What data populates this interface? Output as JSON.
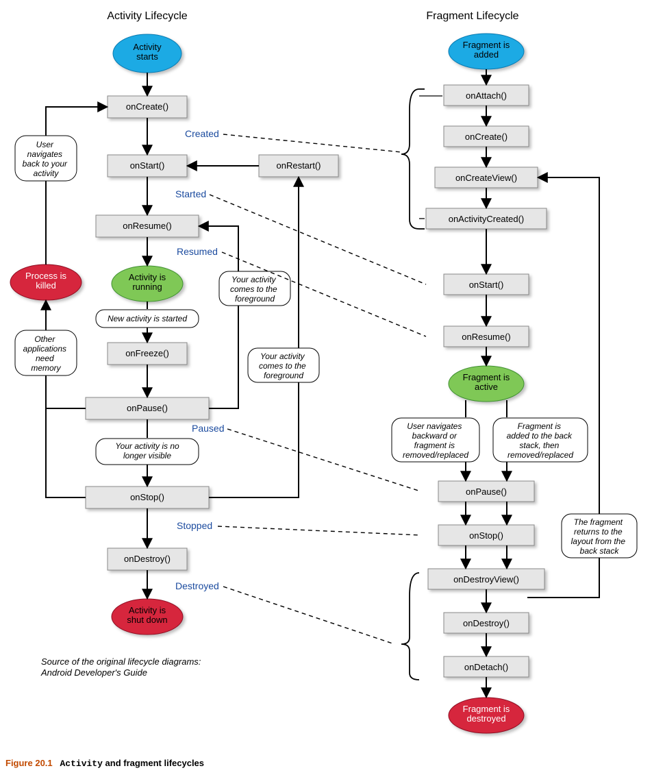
{
  "titles": {
    "activity": "Activity Lifecycle",
    "fragment": "Fragment Lifecycle"
  },
  "activity": {
    "start_ellipse": "Activity\nstarts",
    "onCreate": "onCreate()",
    "onStart": "onStart()",
    "onResume": "onResume()",
    "running_ellipse": "Activity is\nrunning",
    "new_activity_bubble": "New activity is started",
    "onFreeze": "onFreeze()",
    "onPause": "onPause()",
    "no_longer_visible_bubble": "Your activity is no\nlonger visible",
    "onStop": "onStop()",
    "onDestroy": "onDestroy()",
    "shutdown_ellipse": "Activity is\nshut down",
    "onRestart": "onRestart()",
    "user_nav_bubble": "User\nnavigates\nback to your\nactivity",
    "process_killed_ellipse": "Process is\nkilled",
    "other_apps_bubble": "Other\napplications\nneed\nmemory",
    "foreground_bubble1": "Your activity\ncomes to the\nforeground",
    "foreground_bubble2": "Your activity\ncomes to the\nforeground"
  },
  "states": {
    "created": "Created",
    "started": "Started",
    "resumed": "Resumed",
    "paused": "Paused",
    "stopped": "Stopped",
    "destroyed": "Destroyed"
  },
  "fragment": {
    "added_ellipse": "Fragment is\nadded",
    "onAttach": "onAttach()",
    "onCreate": "onCreate()",
    "onCreateView": "onCreateView()",
    "onActivityCreated": "onActivityCreated()",
    "onStart": "onStart()",
    "onResume": "onResume()",
    "active_ellipse": "Fragment is\nactive",
    "user_back_bubble": "User navigates\nbackward or\nfragment is\nremoved/replaced",
    "back_stack_bubble": "Fragment is\nadded to the back\nstack, then\nremoved/replaced",
    "onPause": "onPause()",
    "onStop": "onStop()",
    "onDestroyView": "onDestroyView()",
    "onDestroy": "onDestroy()",
    "onDetach": "onDetach()",
    "destroyed_ellipse": "Fragment is\ndestroyed",
    "returns_bubble": "The fragment\nreturns to the\nlayout from the\nback stack"
  },
  "source_note": "Source of the original lifecycle diagrams:\nAndroid Developer's Guide",
  "caption": {
    "figure": "Figure 20.1",
    "code": "Activity",
    "rest": " and fragment lifecycles"
  },
  "colors": {
    "blue": "#1aaae4",
    "green": "#7fc857",
    "red": "#d6283e",
    "boxfill": "#e6e6e6",
    "boxstroke": "#888",
    "statecolor": "#1a4a9e"
  }
}
